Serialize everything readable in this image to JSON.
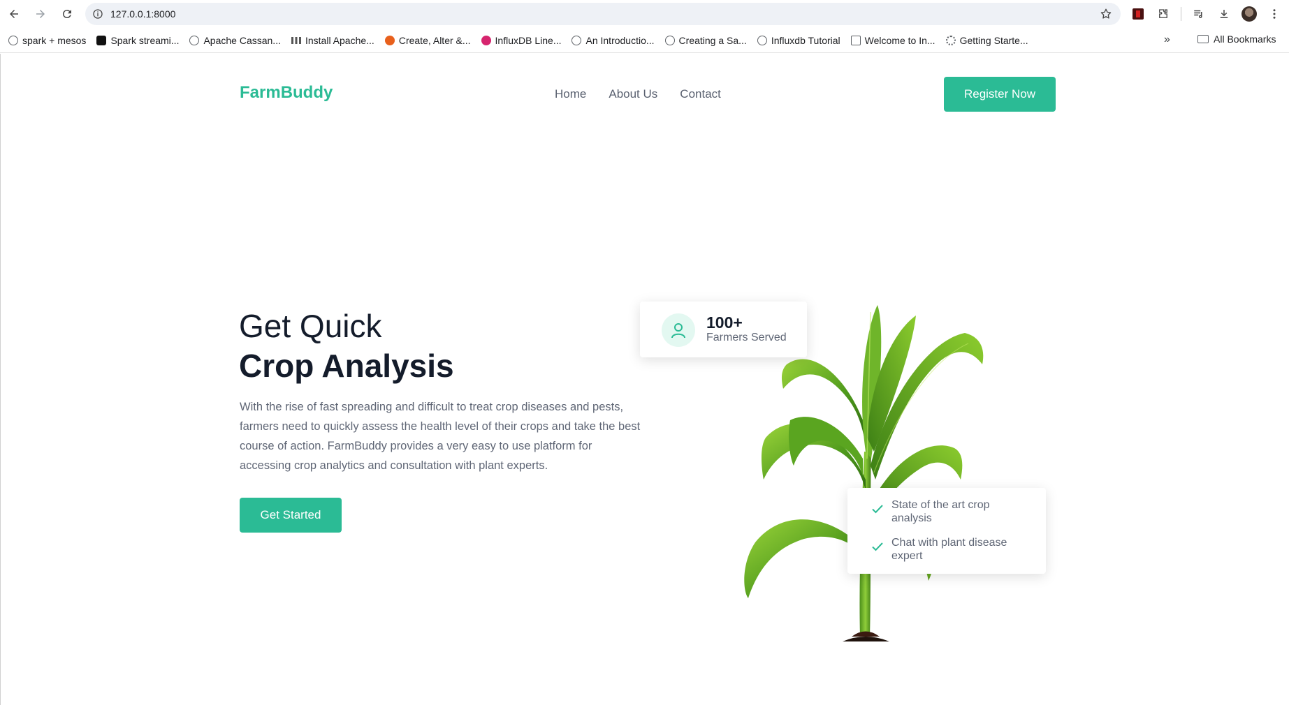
{
  "browser": {
    "url": "127.0.0.1:8000",
    "bookmarks": [
      {
        "label": "spark + mesos",
        "icon": "globe"
      },
      {
        "label": "Spark streami...",
        "icon": "dark"
      },
      {
        "label": "Apache Cassan...",
        "icon": "globe"
      },
      {
        "label": "Install Apache...",
        "icon": "bar"
      },
      {
        "label": "Create, Alter &...",
        "icon": "orange"
      },
      {
        "label": "InfluxDB Line...",
        "icon": "pink"
      },
      {
        "label": "An Introductio...",
        "icon": "globe"
      },
      {
        "label": "Creating a Sa...",
        "icon": "globe"
      },
      {
        "label": "Influxdb Tutorial",
        "icon": "globe"
      },
      {
        "label": "Welcome to In...",
        "icon": "grid"
      },
      {
        "label": "Getting Starte...",
        "icon": "cog"
      }
    ],
    "more_label": "»",
    "all_bookmarks_label": "All Bookmarks"
  },
  "header": {
    "brand": "FarmBuddy",
    "nav": [
      "Home",
      "About Us",
      "Contact"
    ],
    "register_label": "Register Now"
  },
  "hero": {
    "title_line1": "Get Quick",
    "title_line2": "Crop Analysis",
    "description": "With the rise of fast spreading and difficult to treat crop diseases and pests, farmers need to quickly assess the health level of their crops and take the best course of action. FarmBuddy provides a very easy to use platform for accessing crop analytics and consultation with plant experts.",
    "cta_label": "Get Started"
  },
  "stat_card": {
    "value": "100+",
    "label": "Farmers Served"
  },
  "features": [
    "State of the art crop analysis",
    "Chat with plant disease expert"
  ],
  "colors": {
    "accent": "#2bbb95",
    "heading": "#141c2b",
    "body_text": "#5f6675"
  }
}
